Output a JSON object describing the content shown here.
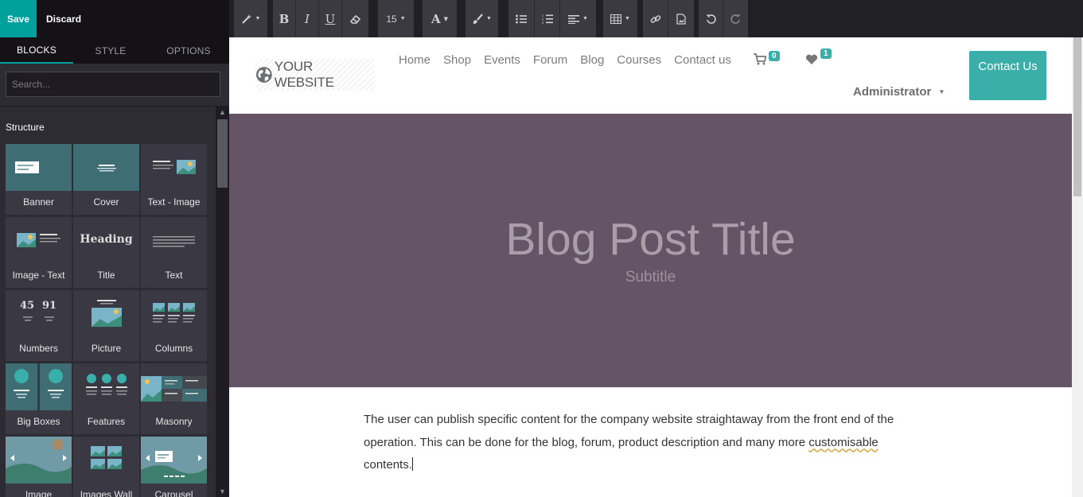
{
  "editor": {
    "save_label": "Save",
    "discard_label": "Discard",
    "tabs": [
      {
        "label": "BLOCKS",
        "active": true
      },
      {
        "label": "STYLE",
        "active": false
      },
      {
        "label": "OPTIONS",
        "active": false
      }
    ],
    "search_placeholder": "Search...",
    "section_label": "Structure",
    "blocks": [
      {
        "label": "Banner",
        "icon": "banner-thumb"
      },
      {
        "label": "Cover",
        "icon": "cover-thumb"
      },
      {
        "label": "Text - Image",
        "icon": "text-image-thumb"
      },
      {
        "label": "Image - Text",
        "icon": "image-text-thumb"
      },
      {
        "label": "Title",
        "icon": "title-thumb",
        "thumb_text": "Heading"
      },
      {
        "label": "Text",
        "icon": "text-thumb"
      },
      {
        "label": "Numbers",
        "icon": "numbers-thumb",
        "thumb_text_a": "45",
        "thumb_text_b": "91"
      },
      {
        "label": "Picture",
        "icon": "picture-thumb"
      },
      {
        "label": "Columns",
        "icon": "columns-thumb"
      },
      {
        "label": "Big Boxes",
        "icon": "big-boxes-thumb"
      },
      {
        "label": "Features",
        "icon": "features-thumb"
      },
      {
        "label": "Masonry",
        "icon": "masonry-thumb"
      },
      {
        "label": "Image",
        "icon": "image-gallery-thumb"
      },
      {
        "label": "Images Wall",
        "icon": "images-wall-thumb"
      },
      {
        "label": "Carousel",
        "icon": "carousel-thumb"
      }
    ]
  },
  "toolbar": {
    "font_size": "15"
  },
  "site": {
    "logo_text": "YOUR WEBSITE",
    "nav": [
      "Home",
      "Shop",
      "Events",
      "Forum",
      "Blog",
      "Courses",
      "Contact us"
    ],
    "cart_count": "0",
    "wishlist_count": "1",
    "admin_label": "Administrator",
    "contact_button": "Contact Us",
    "hero_title": "Blog Post Title",
    "hero_subtitle": "Subtitle",
    "body_text_before": "The user can publish specific content for the company website straightaway from the front end of the operation. This can be done for the blog, forum, product description and many more ",
    "body_text_spell": "customisable",
    "body_text_after": " contents."
  },
  "colors": {
    "accent": "#00a09d",
    "badge": "#3aafa9",
    "hero_bg": "#655466",
    "sidebar_bg": "#2d2b33",
    "toolbar_bg": "#212024"
  }
}
